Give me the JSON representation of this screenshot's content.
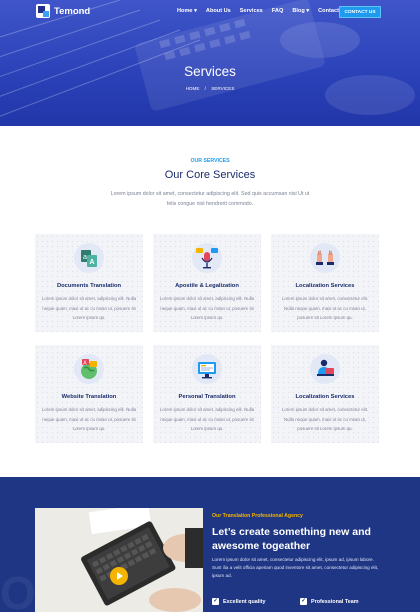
{
  "brand": {
    "name": "Temond"
  },
  "nav": {
    "items": [
      {
        "label": "Home",
        "dropdown": true
      },
      {
        "label": "About Us",
        "dropdown": false
      },
      {
        "label": "Services",
        "dropdown": false
      },
      {
        "label": "FAQ",
        "dropdown": false
      },
      {
        "label": "Blog",
        "dropdown": true
      },
      {
        "label": "Contact",
        "dropdown": false
      }
    ],
    "cta": "CONTACT US",
    "dropdown_glyph": "▾"
  },
  "hero": {
    "title": "Services",
    "breadcrumb": {
      "home": "HOME",
      "separator": "/",
      "current": "SERVICES"
    }
  },
  "services_section": {
    "eyebrow": "OUR SERVICES",
    "title": "Our Core Services",
    "description": "Lorem ipsum dolor sit amet, consectetur adipiscing elit. Sed quis accumsan nisi Ut ut felis congue nisl hendrerit commodo."
  },
  "services": [
    {
      "title": "Documents Translation",
      "icon": "document-translate-icon",
      "text": "Lorem ipsum dolor sit amet, adipiscing elit. Nulla neque quam, maxi ut ac cu msan ut, posuere sit Lorem ipsum qu."
    },
    {
      "title": "Apostile & Legalization",
      "icon": "microphone-icon",
      "text": "Lorem ipsum dolor sit amet, adipiscing elit. Nulla neque quam, maxi ut ac cu msan ut, posuere sit Lorem ipsum qu."
    },
    {
      "title": "Localization Services",
      "icon": "handshake-icon",
      "text": "Lorem ipsum dolor sit amet, consectetur elit. Nulla neque quam, maxi ut ac cu msan ut, posuere sit Lorem ipsum qu."
    },
    {
      "title": "Website Translation",
      "icon": "globe-translate-icon",
      "text": "Lorem ipsum dolor sit amet, adipiscing elit. Nulla neque quam, maxi ut ac cu msan ut, posuere sit Lorem ipsum qu."
    },
    {
      "title": "Personal Translation",
      "icon": "monitor-icon",
      "text": "Lorem ipsum dolor sit amet, adipiscing elit. Nulla neque quam, maxi ut ac cu msan ut, posuere sit Lorem ipsum qu."
    },
    {
      "title": "Localization Services",
      "icon": "person-laptop-icon",
      "text": "Lorem ipsum dolor sit amet, consectetur elit. Nulla neque quam, maxi ut ac cu msan ut, posuere sit Lorem ipsum qu."
    }
  ],
  "about": {
    "eyebrow": "Our Translation Professional Agency",
    "title": "Let’s create something new and awesome togeather",
    "text": "Lorem ipsum dolor sit amet, consectetur adipiscing elit, ipsum ad, ipsum labore. Sunt ilia a velit officia aperiam quod inventore sit amet, consectetur adipiscing elit, ipsum ad.",
    "watermark": "OUR ST",
    "features": [
      "Excellent quality",
      "Professional Team"
    ],
    "check_glyph": "✓"
  },
  "colors": {
    "primary_blue": "#2a41b8",
    "navy": "#1f3685",
    "accent_sky": "#1e9bf0",
    "accent_gold": "#f5b400",
    "card_bg": "#f3f4f8"
  }
}
